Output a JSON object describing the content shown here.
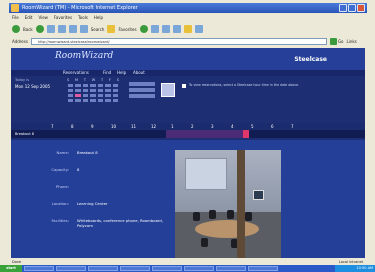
{
  "window": {
    "title": "RoomWizard (TM) - Microsoft Internet Explorer"
  },
  "menu": [
    "File",
    "Edit",
    "View",
    "Favorites",
    "Tools",
    "Help"
  ],
  "toolbar": {
    "back_label": "Back",
    "search_label": "Search",
    "favorites_label": "Favorites"
  },
  "address": {
    "label": "Address",
    "url": "http://roomwizard.steelcase/roomwizard/",
    "go_label": "Go",
    "links_label": "Links"
  },
  "app": {
    "logo": "RoomWizard",
    "brand": "Steelcase",
    "nav": [
      "Reservations",
      "Find",
      "Help",
      "About"
    ],
    "today_label": "Today is",
    "today_value": "Mon 12 Sep 2005",
    "calendar_header": [
      "S",
      "M",
      "T",
      "W",
      "T",
      "F",
      "S"
    ],
    "note": "To view reservations, select a Steelcase hour time in the date above."
  },
  "timeline": {
    "hours": [
      "7",
      "8",
      "9",
      "10",
      "11",
      "12",
      "1",
      "2",
      "3",
      "4",
      "5",
      "6",
      "7"
    ],
    "room_label": "Breakout 8"
  },
  "details": {
    "fields": [
      {
        "key": "Name:",
        "value": "Breakout 8"
      },
      {
        "key": "Capacity:",
        "value": "8"
      },
      {
        "key": "Phone:",
        "value": ""
      },
      {
        "key": "Location:",
        "value": "Learning Center"
      },
      {
        "key": "Facilities:",
        "value": "Whiteboards, conference phone, Roomboard, Polycom"
      }
    ]
  },
  "status": {
    "left": "Done",
    "right": "Local intranet"
  },
  "taskbar": {
    "start": "start",
    "clock": "10:50 AM"
  },
  "colors": {
    "page_bg": "#1d2f72",
    "detail_bg": "#243f98",
    "booked": "#4b2a76",
    "current": "#e0366a"
  }
}
